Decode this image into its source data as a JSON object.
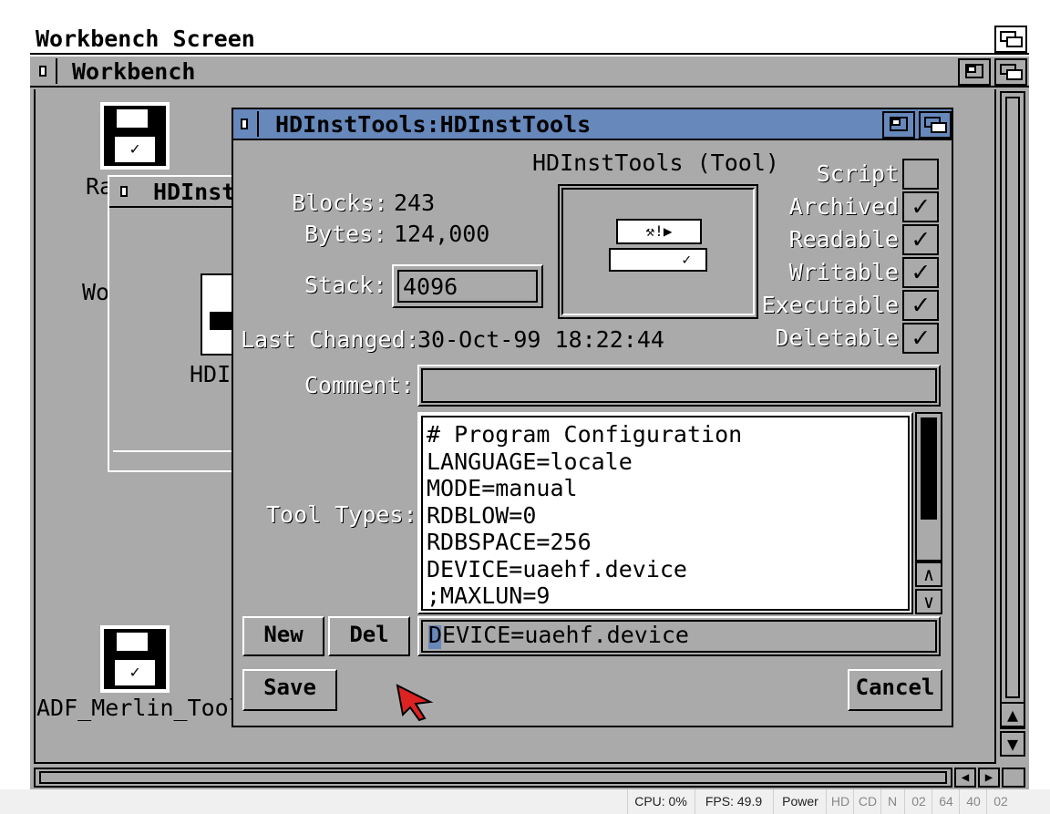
{
  "screen": {
    "title": "Workbench Screen"
  },
  "workbench": {
    "title": "Workbench",
    "icons": [
      {
        "label": "Ra"
      },
      {
        "label": "Wo"
      },
      {
        "label": "HDI"
      },
      {
        "label": "ADF_Merlin_Tools"
      }
    ],
    "hdinst_window_title": "HDInst"
  },
  "dialog": {
    "title": "HDInstTools:HDInstTools",
    "heading": "HDInstTools (Tool)",
    "blocks_label": "Blocks:",
    "blocks_value": "243",
    "bytes_label": "Bytes:",
    "bytes_value": "124,000",
    "stack_label": "Stack:",
    "stack_value": "4096",
    "last_changed_label": "Last Changed:",
    "last_changed_value": "30-Oct-99 18:22:44",
    "comment_label": "Comment:",
    "comment_value": "",
    "tooltypes_label": "Tool Types:",
    "tooltypes": [
      "# Program Configuration",
      "LANGUAGE=locale",
      "MODE=manual",
      "RDBLOW=0",
      "RDBSPACE=256",
      "DEVICE=uaehf.device",
      ";MAXLUN=9"
    ],
    "tooltype_edit_value": "DEVICE=uaehf.device",
    "new_label": "New",
    "del_label": "Del",
    "save_label": "Save",
    "cancel_label": "Cancel",
    "protection": [
      {
        "label": "Script",
        "checked": false
      },
      {
        "label": "Archived",
        "checked": true
      },
      {
        "label": "Readable",
        "checked": true
      },
      {
        "label": "Writable",
        "checked": true
      },
      {
        "label": "Executable",
        "checked": true
      },
      {
        "label": "Deletable",
        "checked": true
      }
    ]
  },
  "statusbar": {
    "cpu": "CPU: 0%",
    "fps": "FPS: 49.9",
    "power": "Power",
    "hd": "HD",
    "cd": "CD",
    "n": "N",
    "d1": "02",
    "d2": "64",
    "d3": "40",
    "d4": "02"
  },
  "colors": {
    "workbench_gray": "#aaaaaa",
    "title_blue": "#6688bb",
    "pointer_red": "#dd2222"
  }
}
